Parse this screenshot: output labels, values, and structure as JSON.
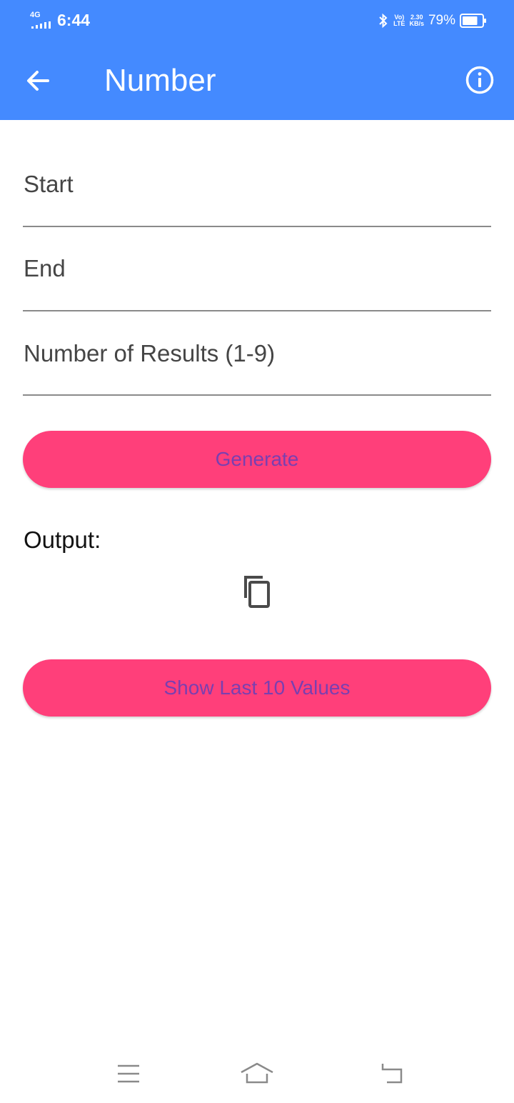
{
  "status_bar": {
    "network": "4G",
    "time": "6:44",
    "volte_top": "Vo)",
    "volte_bottom": "LTE",
    "speed_top": "2.30",
    "speed_bottom": "KB/s",
    "battery_percent": "79%",
    "battery_level": 0.79
  },
  "app_bar": {
    "title": "Number",
    "color": "#448aff"
  },
  "form": {
    "start_label": "Start",
    "start_value": "",
    "end_label": "End",
    "end_value": "",
    "count_label": "Number of Results (1-9)",
    "count_value": ""
  },
  "actions": {
    "generate_label": "Generate",
    "history_label": "Show Last 10 Values",
    "button_color": "#ff3f7a",
    "button_text_color": "#7a3fb0"
  },
  "output": {
    "label": "Output:",
    "value": ""
  },
  "icons": {
    "back": "arrow-left-icon",
    "info": "info-icon",
    "copy": "copy-icon",
    "nav_menu": "menu-icon",
    "nav_home": "home-icon",
    "nav_back": "return-icon"
  }
}
